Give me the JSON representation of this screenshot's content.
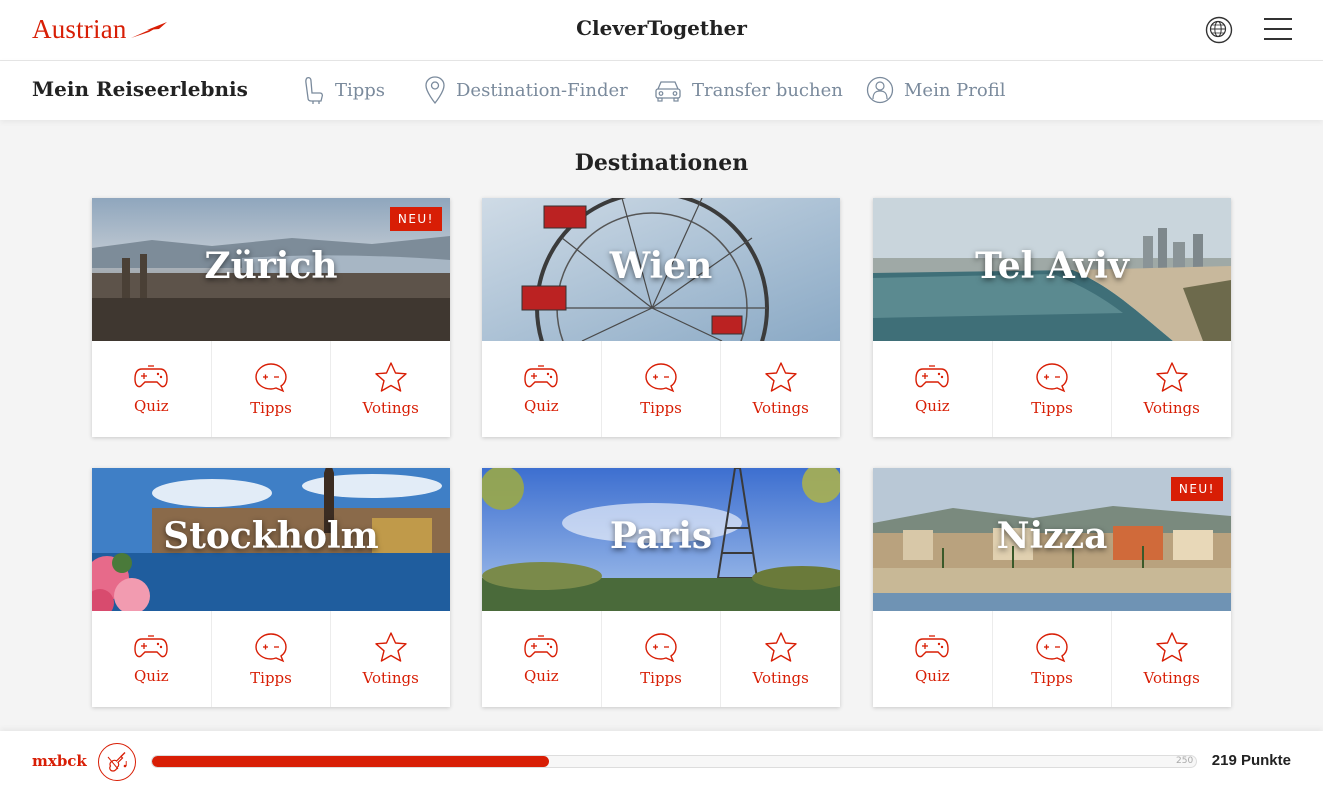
{
  "header": {
    "logo_text": "Austrian",
    "app_title": "CleverTogether"
  },
  "subnav": {
    "title": "Mein Reiseerlebnis",
    "items": [
      {
        "label": "Tipps",
        "icon": "seat-icon"
      },
      {
        "label": "Destination-Finder",
        "icon": "location-pin-icon"
      },
      {
        "label": "Transfer buchen",
        "icon": "car-icon"
      },
      {
        "label": "Mein Profil",
        "icon": "user-icon"
      }
    ]
  },
  "section_title": "Destinationen",
  "cards": [
    {
      "name": "Zürich",
      "badge": "NEU!"
    },
    {
      "name": "Wien",
      "badge": ""
    },
    {
      "name": "Tel Aviv",
      "badge": ""
    },
    {
      "name": "Stockholm",
      "badge": ""
    },
    {
      "name": "Paris",
      "badge": ""
    },
    {
      "name": "Nizza",
      "badge": "NEU!"
    }
  ],
  "actions": {
    "quiz": "Quiz",
    "tips": "Tipps",
    "votings": "Votings"
  },
  "footer": {
    "username": "mxbck",
    "progress_value": 219,
    "progress_max": "250",
    "points_label": "219 Punkte"
  },
  "colors": {
    "brand": "#d81e05",
    "nav_text": "#7a8a9c"
  }
}
